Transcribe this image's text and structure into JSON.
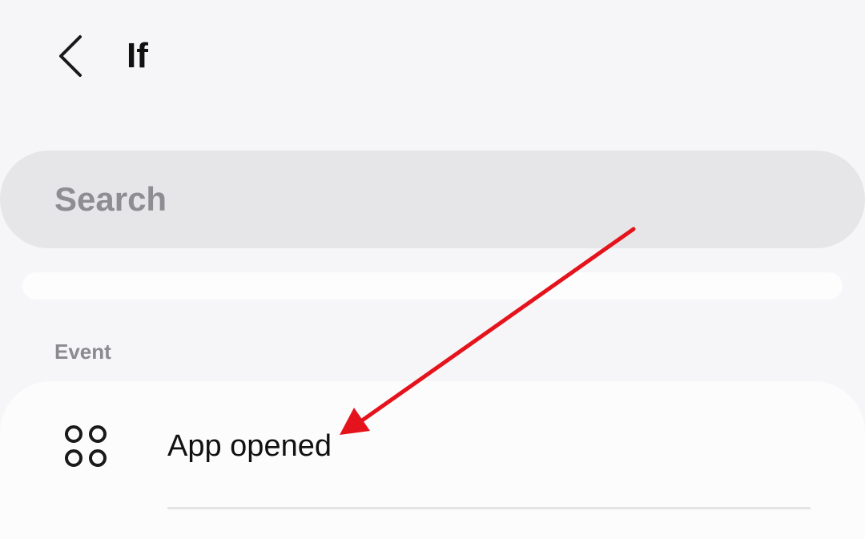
{
  "header": {
    "title": "If",
    "back_icon": "chevron-left-icon"
  },
  "search": {
    "placeholder": "Search",
    "value": ""
  },
  "sections": [
    {
      "label": "Event",
      "items": [
        {
          "label": "App opened",
          "icon": "apps-grid-icon"
        }
      ]
    }
  ],
  "colors": {
    "background": "#f6f6f8",
    "search_bg": "#e6e6e9",
    "card_bg": "#fcfcfd",
    "annotation_arrow": "#e5131b"
  }
}
